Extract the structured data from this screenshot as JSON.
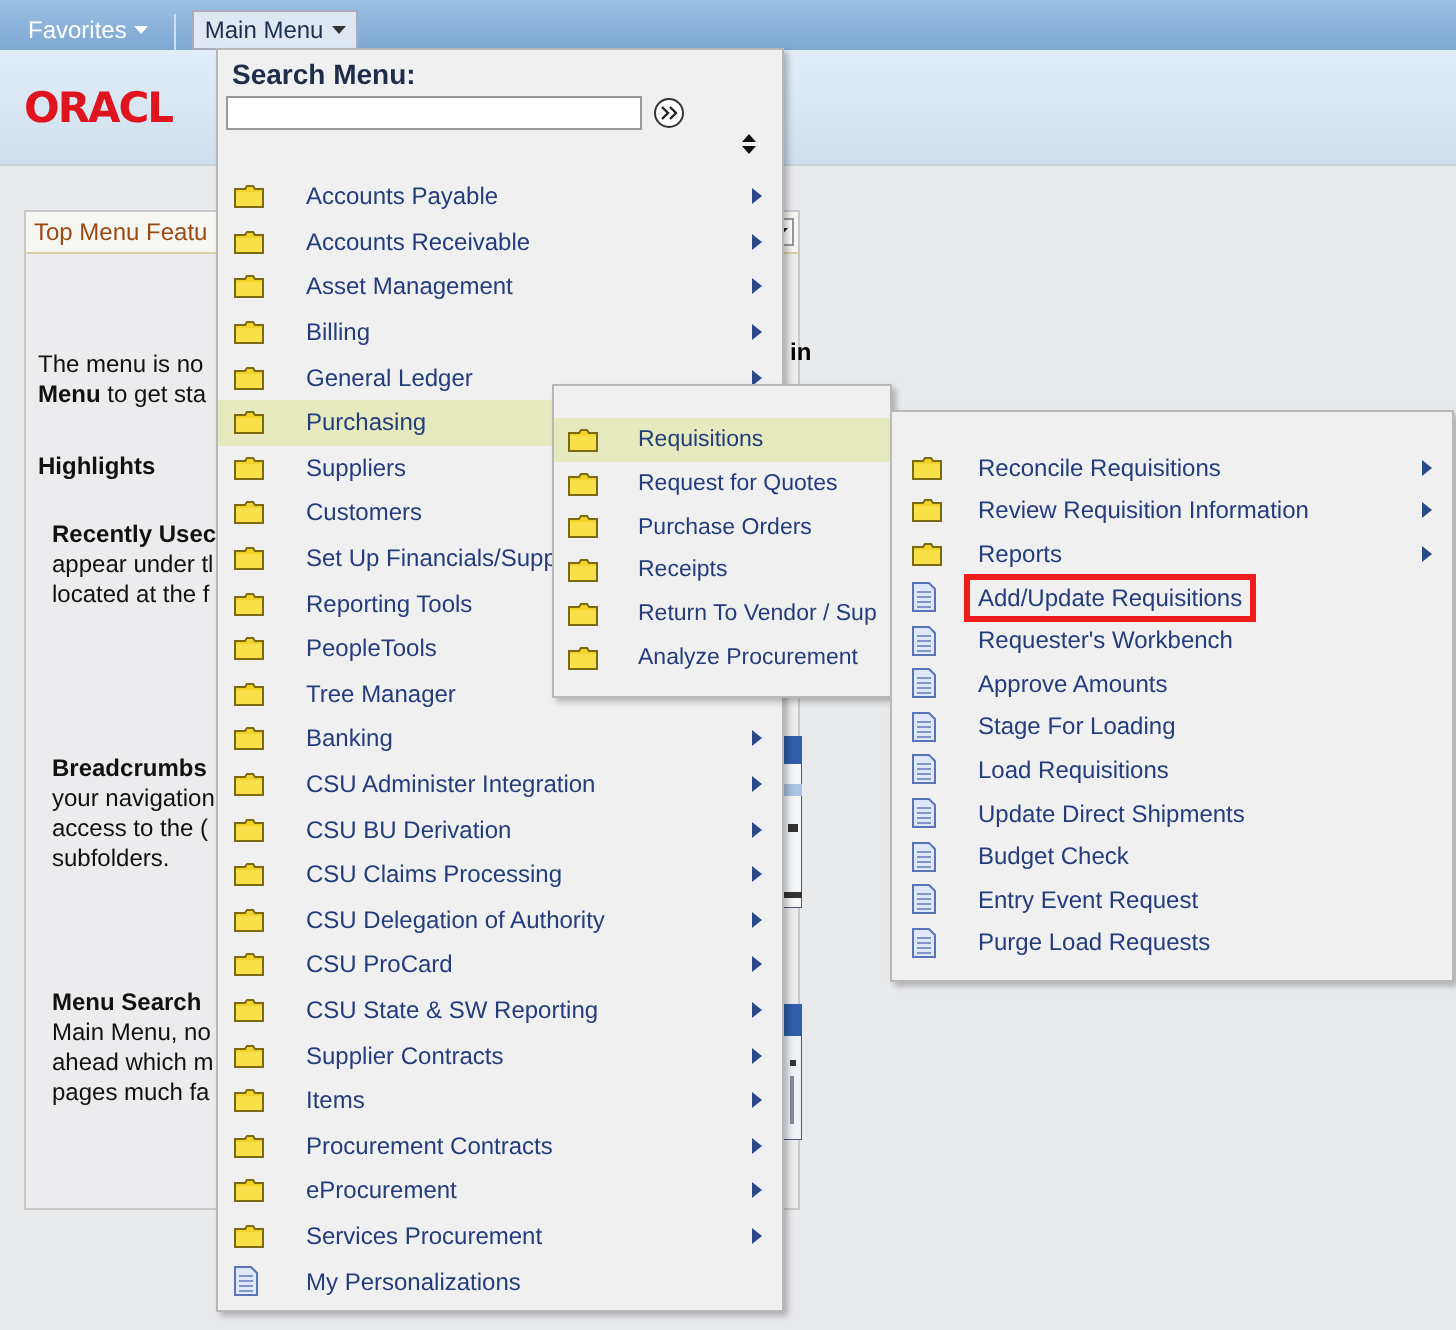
{
  "top_bar": {
    "tabs": [
      {
        "label": "Favorites",
        "selected": false
      },
      {
        "label": "Main Menu",
        "selected": true
      }
    ]
  },
  "logo": "ORACL",
  "background_page": {
    "panel_title": "Top Menu Featu",
    "intro": [
      "The menu is no",
      "**Menu** to get sta"
    ],
    "intro_right": "in",
    "heading": "Highlights",
    "sections": [
      {
        "title": "Recently Usec",
        "lines": [
          "appear under tl",
          "located at the f"
        ]
      },
      {
        "title": "Breadcrumbs",
        "lines": [
          "your navigation",
          "access to the (",
          "subfolders."
        ]
      },
      {
        "title": "Menu Search",
        "lines": [
          "Main Menu, no",
          "ahead which m",
          "pages much fa"
        ]
      }
    ]
  },
  "main_menu": {
    "search_label": "Search Menu:",
    "items": [
      {
        "label": "Accounts Payable",
        "kind": "folder",
        "selected": false,
        "submenu": true
      },
      {
        "label": "Accounts Receivable",
        "kind": "folder",
        "selected": false,
        "submenu": true
      },
      {
        "label": "Asset Management",
        "kind": "folder",
        "selected": false,
        "submenu": true
      },
      {
        "label": "Billing",
        "kind": "folder",
        "selected": false,
        "submenu": true
      },
      {
        "label": "General Ledger",
        "kind": "folder",
        "selected": false,
        "submenu": true
      },
      {
        "label": "Purchasing",
        "kind": "folder",
        "selected": true,
        "submenu": false
      },
      {
        "label": "Suppliers",
        "kind": "folder",
        "selected": false,
        "submenu": false
      },
      {
        "label": "Customers",
        "kind": "folder",
        "selected": false,
        "submenu": false
      },
      {
        "label": "Set Up Financials/Supp",
        "kind": "folder",
        "selected": false,
        "submenu": false
      },
      {
        "label": "Reporting Tools",
        "kind": "folder",
        "selected": false,
        "submenu": false
      },
      {
        "label": "PeopleTools",
        "kind": "folder",
        "selected": false,
        "submenu": false
      },
      {
        "label": "Tree Manager",
        "kind": "folder",
        "selected": false,
        "submenu": false
      },
      {
        "label": "Banking",
        "kind": "folder",
        "selected": false,
        "submenu": true
      },
      {
        "label": "CSU Administer Integration",
        "kind": "folder",
        "selected": false,
        "submenu": true
      },
      {
        "label": "CSU BU Derivation",
        "kind": "folder",
        "selected": false,
        "submenu": true
      },
      {
        "label": "CSU Claims Processing",
        "kind": "folder",
        "selected": false,
        "submenu": true
      },
      {
        "label": "CSU Delegation of Authority",
        "kind": "folder",
        "selected": false,
        "submenu": true
      },
      {
        "label": "CSU ProCard",
        "kind": "folder",
        "selected": false,
        "submenu": true
      },
      {
        "label": "CSU State & SW Reporting",
        "kind": "folder",
        "selected": false,
        "submenu": true
      },
      {
        "label": "Supplier Contracts",
        "kind": "folder",
        "selected": false,
        "submenu": true
      },
      {
        "label": "Items",
        "kind": "folder",
        "selected": false,
        "submenu": true
      },
      {
        "label": "Procurement Contracts",
        "kind": "folder",
        "selected": false,
        "submenu": true
      },
      {
        "label": "eProcurement",
        "kind": "folder",
        "selected": false,
        "submenu": true
      },
      {
        "label": "Services Procurement",
        "kind": "folder",
        "selected": false,
        "submenu": true
      },
      {
        "label": "My Personalizations",
        "kind": "page",
        "selected": false,
        "submenu": false
      }
    ]
  },
  "purchasing_menu": {
    "items": [
      {
        "label": "Requisitions",
        "kind": "folder",
        "selected": true
      },
      {
        "label": "Request for Quotes",
        "kind": "folder",
        "selected": false
      },
      {
        "label": "Purchase Orders",
        "kind": "folder",
        "selected": false
      },
      {
        "label": "Receipts",
        "kind": "folder",
        "selected": false
      },
      {
        "label": "Return To Vendor / Sup",
        "kind": "folder",
        "selected": false
      },
      {
        "label": "Analyze Procurement",
        "kind": "folder",
        "selected": false
      }
    ]
  },
  "requisitions_menu": {
    "items": [
      {
        "label": "Reconcile Requisitions",
        "kind": "folder",
        "submenu": true,
        "highlighted": false
      },
      {
        "label": "Review Requisition Information",
        "kind": "folder",
        "submenu": true,
        "highlighted": false
      },
      {
        "label": "Reports",
        "kind": "folder",
        "submenu": true,
        "highlighted": false
      },
      {
        "label": "Add/Update Requisitions",
        "kind": "page",
        "submenu": false,
        "highlighted": true
      },
      {
        "label": "Requester's Workbench",
        "kind": "page",
        "submenu": false,
        "highlighted": false
      },
      {
        "label": "Approve Amounts",
        "kind": "page",
        "submenu": false,
        "highlighted": false
      },
      {
        "label": "Stage For Loading",
        "kind": "page",
        "submenu": false,
        "highlighted": false
      },
      {
        "label": "Load Requisitions",
        "kind": "page",
        "submenu": false,
        "highlighted": false
      },
      {
        "label": "Update Direct Shipments",
        "kind": "page",
        "submenu": false,
        "highlighted": false
      },
      {
        "label": "Budget Check",
        "kind": "page",
        "submenu": false,
        "highlighted": false
      },
      {
        "label": "Entry Event Request",
        "kind": "page",
        "submenu": false,
        "highlighted": false
      },
      {
        "label": "Purge Load Requests",
        "kind": "page",
        "submenu": false,
        "highlighted": false
      }
    ]
  }
}
